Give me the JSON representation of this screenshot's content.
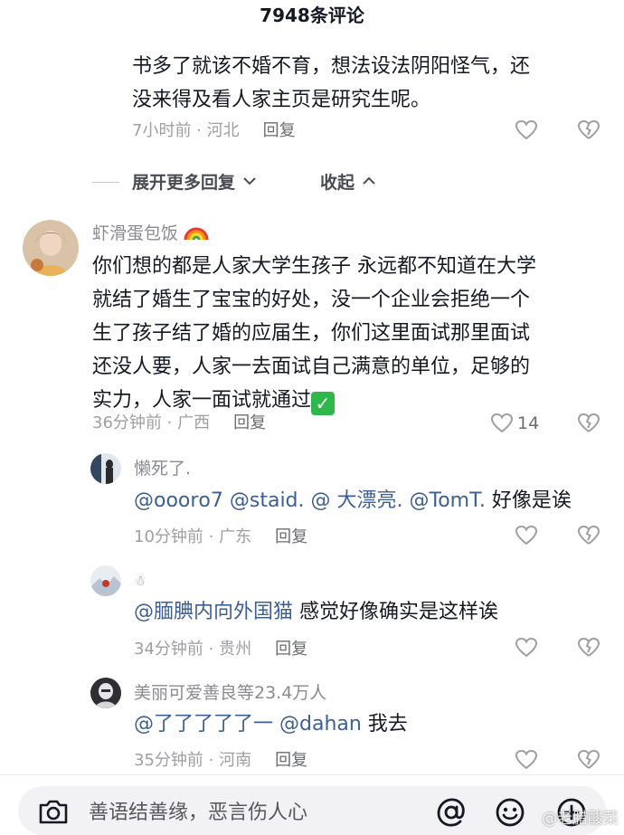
{
  "header": {
    "title": "7948条评论"
  },
  "comment0": {
    "text_line1": "书多了就该不婚不育，想法设法阴阳怪气，还",
    "text_line2": "没来得及看人家主页是研究生呢。",
    "meta": "7小时前 · 河北",
    "reply": "回复"
  },
  "thread_controls": {
    "expand": "展开更多回复",
    "collapse": "收起"
  },
  "comment1": {
    "username": "虾滑蛋包饭",
    "username_emoji": "rainbow-emoji",
    "lines": [
      "你们想的都是人家大学生孩子 永远都不知道在大学",
      "就结了婚生了宝宝的好处，没一个企业会拒绝一个",
      "生了孩子结了婚的应届生，你们这里面试那里面试",
      "还没人要，人家一去面试自己满意的单位，足够的",
      "实力，人家一面试就通过"
    ],
    "emoji": "check-mark-emoji",
    "meta": "36分钟前 · 广西",
    "reply": "回复",
    "like_count": "14"
  },
  "reply1": {
    "username": "懒死了.",
    "mention": "@ooorо7 @staid. @ 大漂亮. @TomT.",
    "text": " 好像是诶",
    "meta": "10分钟前 · 广东",
    "reply": "回复"
  },
  "reply2": {
    "username": "☃",
    "mention": "@腼腆内向外国猫",
    "text": " 感觉好像确实是这样诶",
    "meta": "34分钟前 · 贵州",
    "reply": "回复"
  },
  "reply3": {
    "username": "美丽可爱善良等23.4万人",
    "mention": "@了了了了了一 @dahan",
    "text": " 我去",
    "meta": "35分钟前 · 河南",
    "reply": "回复"
  },
  "input": {
    "placeholder": "善语结善缘，恶言伤人心"
  },
  "watermark": "@老腊酸菜",
  "colors": {
    "mention": "#3d5f93",
    "meta": "#9e9fa3",
    "check": "#2eb84b"
  }
}
